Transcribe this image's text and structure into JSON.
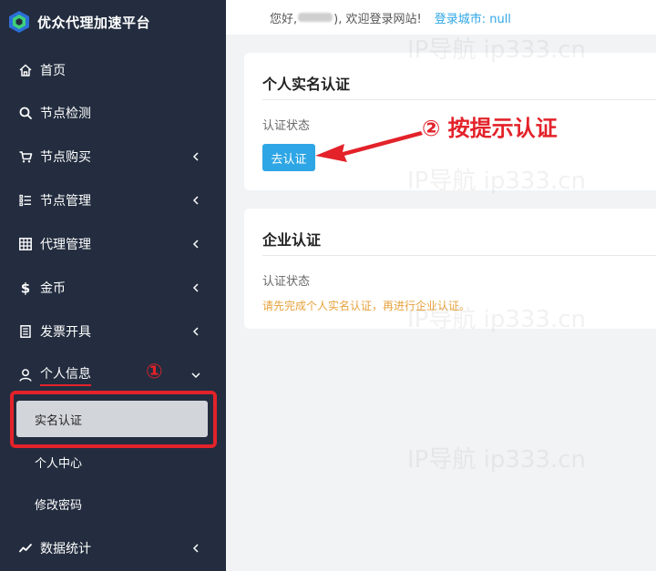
{
  "brand": {
    "title": "优众代理加速平台"
  },
  "sidebar": {
    "items": [
      {
        "label": "首页",
        "icon": "home-icon",
        "has_arrow": false
      },
      {
        "label": "节点检测",
        "icon": "search-icon",
        "has_arrow": false
      },
      {
        "label": "节点购买",
        "icon": "cart-icon",
        "has_arrow": true
      },
      {
        "label": "节点管理",
        "icon": "list-icon",
        "has_arrow": true
      },
      {
        "label": "代理管理",
        "icon": "grid-icon",
        "has_arrow": true
      },
      {
        "label": "金币",
        "icon": "dollar-icon",
        "has_arrow": true
      },
      {
        "label": "发票开具",
        "icon": "invoice-icon",
        "has_arrow": true
      },
      {
        "label": "个人信息",
        "icon": "user-icon",
        "has_arrow": true,
        "expanded": true
      },
      {
        "label": "数据统计",
        "icon": "chart-icon",
        "has_arrow": true
      }
    ],
    "sub_items": [
      {
        "label": "实名认证",
        "active": true
      },
      {
        "label": "个人中心",
        "active": false
      },
      {
        "label": "修改密码",
        "active": false
      }
    ]
  },
  "topbar": {
    "greeting_prefix": "您好,",
    "greeting_suffix": "), 欢迎登录网站!",
    "city_label": "登录城市: null"
  },
  "personal_card": {
    "title": "个人实名认证",
    "status_label": "认证状态",
    "button_label": "去认证"
  },
  "company_card": {
    "title": "企业认证",
    "status_label": "认证状态",
    "notice": "请先完成个人实名认证，再进行企业认证。"
  },
  "annotations": {
    "step1": "①",
    "step2": "② 按提示认证"
  },
  "watermark": "IP导航  ip333.cn",
  "colors": {
    "sidebar_bg": "#232d3f",
    "accent": "#2ea6e5",
    "annotation": "#e3222a",
    "warning": "#e6a23c"
  }
}
